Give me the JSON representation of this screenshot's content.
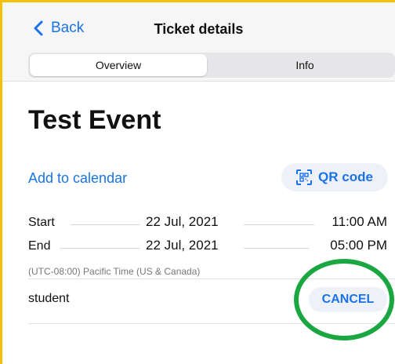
{
  "nav": {
    "back_label": "Back",
    "title": "Ticket details"
  },
  "tabs": [
    {
      "label": "Overview",
      "selected": true
    },
    {
      "label": "Info",
      "selected": false
    }
  ],
  "event": {
    "title": "Test Event",
    "add_to_calendar": "Add to calendar",
    "qr_label": "QR code",
    "start": {
      "label": "Start",
      "date": "22 Jul, 2021",
      "time": "11:00 AM"
    },
    "end": {
      "label": "End",
      "date": "22 Jul, 2021",
      "time": "05:00 PM"
    },
    "timezone": "(UTC-08:00) Pacific Time (US & Canada)"
  },
  "attendee": {
    "name": "student",
    "cancel_label": "CANCEL"
  },
  "colors": {
    "accent": "#1a73e8",
    "frame_border": "#f2c100",
    "annotation": "#1aa640"
  }
}
